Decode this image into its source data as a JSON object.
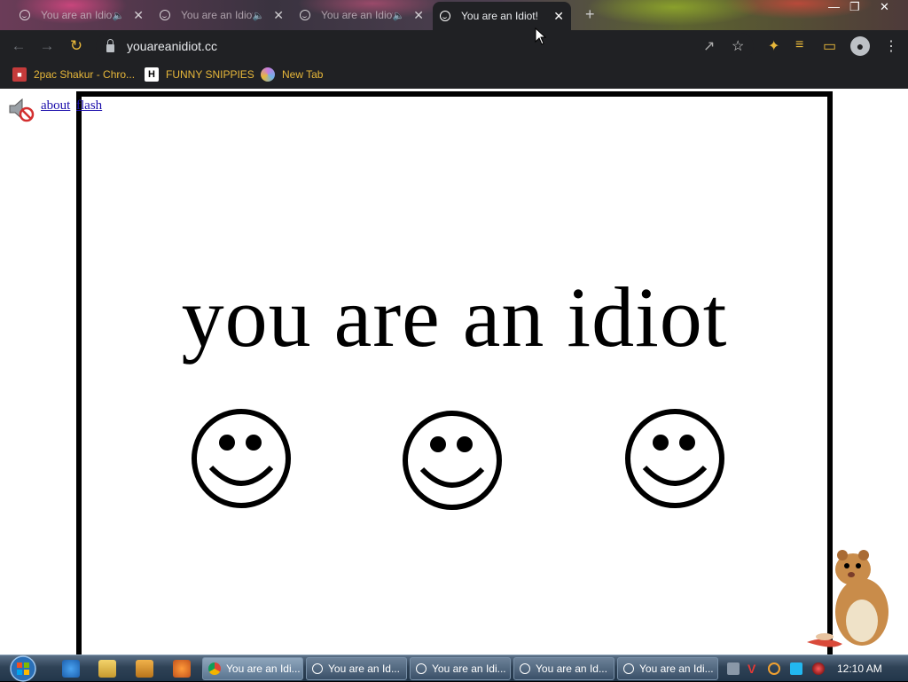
{
  "browser": {
    "tabs": [
      {
        "title": "You are an Idiot!",
        "active": false
      },
      {
        "title": "You are an Idiot!",
        "active": false
      },
      {
        "title": "You are an Idiot!",
        "active": false
      },
      {
        "title": "You are an Idiot!",
        "active": true
      }
    ],
    "url": "youareanidiot.cc",
    "bookmarks": [
      {
        "label": "2pac Shakur - Chro..."
      },
      {
        "label": "FUNNY SNIPPIES"
      },
      {
        "label": "New Tab"
      }
    ]
  },
  "page": {
    "links": {
      "about": "about",
      "flash": "flash"
    },
    "headline": "you are an idiot"
  },
  "taskbar": {
    "windows": [
      {
        "title": "You are an Idi...",
        "active": true
      },
      {
        "title": "You are an Id...",
        "active": false
      },
      {
        "title": "You are an Idi...",
        "active": false
      },
      {
        "title": "You are an Id...",
        "active": false
      },
      {
        "title": "You are an Idi...",
        "active": false
      }
    ],
    "clock": "12:10 AM"
  },
  "colors": {
    "browser_dark": "#202124",
    "bookmark_text": "#e8b83a",
    "link_blue": "#1a0dab"
  }
}
